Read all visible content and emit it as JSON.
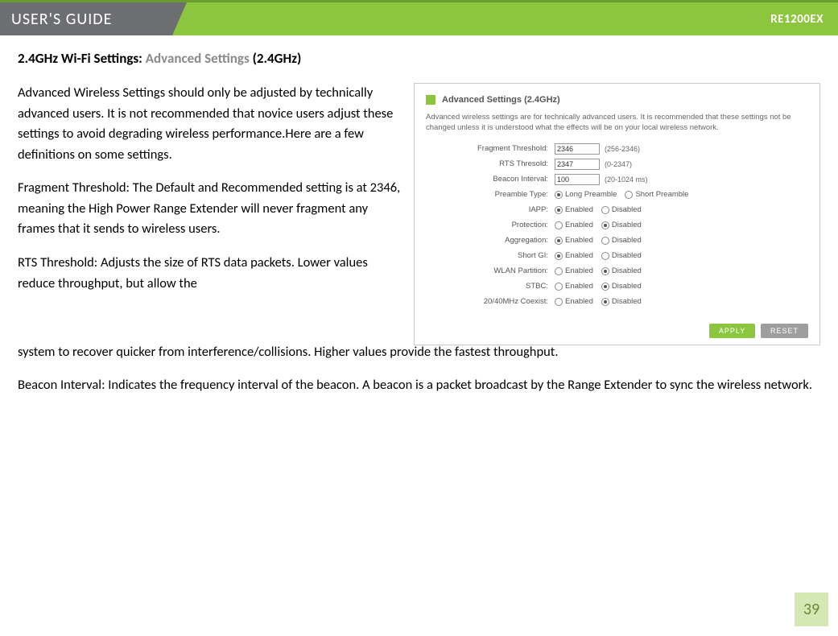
{
  "header": {
    "left": "USER'S GUIDE",
    "right": "RE1200EX"
  },
  "title": {
    "prefix": "2.4GHz Wi-Fi Settings: ",
    "gray": "Advanced Settings ",
    "suffix": "(2.4GHz)"
  },
  "body": {
    "p1": "Advanced Wireless Settings should only be adjusted by technically advanced users. It is not recommended that novice users adjust these settings to avoid degrading wireless performance.Here are a few definitions on some settings.",
    "p2": "Fragment Threshold: The Default and Recommended setting is at 2346, meaning the High Power Range Extender will never fragment any frames that it sends to wireless users.",
    "p3": "RTS Threshold: Adjusts the size of RTS data packets. Lower values reduce throughput, but allow the system to recover quicker from interference/collisions. Higher values provide the fastest throughput.",
    "p4": "Beacon Interval: Indicates the frequency interval of the beacon. A beacon is a packet broadcast by the Range Extender to sync the wireless network."
  },
  "panel": {
    "title": "Advanced Settings (2.4GHz)",
    "desc": "Advanced wireless settings are for technically advanced users. It is recommended that these settings not be changed unless it is understood what the effects will be on your local wireless network.",
    "rows": [
      {
        "label": "Fragment Threshold:",
        "type": "text",
        "value": "2346",
        "hint": "(256-2346)"
      },
      {
        "label": "RTS Thresold:",
        "type": "text",
        "value": "2347",
        "hint": "(0-2347)"
      },
      {
        "label": "Beacon Interval:",
        "type": "text",
        "value": "100",
        "hint": "(20-1024 ms)"
      },
      {
        "label": "Preamble Type:",
        "type": "radio",
        "options": [
          "Long Preamble",
          "Short Preamble"
        ],
        "selected": 0
      },
      {
        "label": "IAPP:",
        "type": "radio",
        "options": [
          "Enabled",
          "Disabled"
        ],
        "selected": 0
      },
      {
        "label": "Protection:",
        "type": "radio",
        "options": [
          "Enabled",
          "Disabled"
        ],
        "selected": 1
      },
      {
        "label": "Aggregation:",
        "type": "radio",
        "options": [
          "Enabled",
          "Disabled"
        ],
        "selected": 0
      },
      {
        "label": "Short GI:",
        "type": "radio",
        "options": [
          "Enabled",
          "Disabled"
        ],
        "selected": 0
      },
      {
        "label": "WLAN Partition:",
        "type": "radio",
        "options": [
          "Enabled",
          "Disabled"
        ],
        "selected": 1
      },
      {
        "label": "STBC:",
        "type": "radio",
        "options": [
          "Enabled",
          "Disabled"
        ],
        "selected": 1
      },
      {
        "label": "20/40MHz Coexist:",
        "type": "radio",
        "options": [
          "Enabled",
          "Disabled"
        ],
        "selected": 1
      }
    ],
    "apply": "APPLY",
    "reset": "RESET"
  },
  "page_number": "39"
}
